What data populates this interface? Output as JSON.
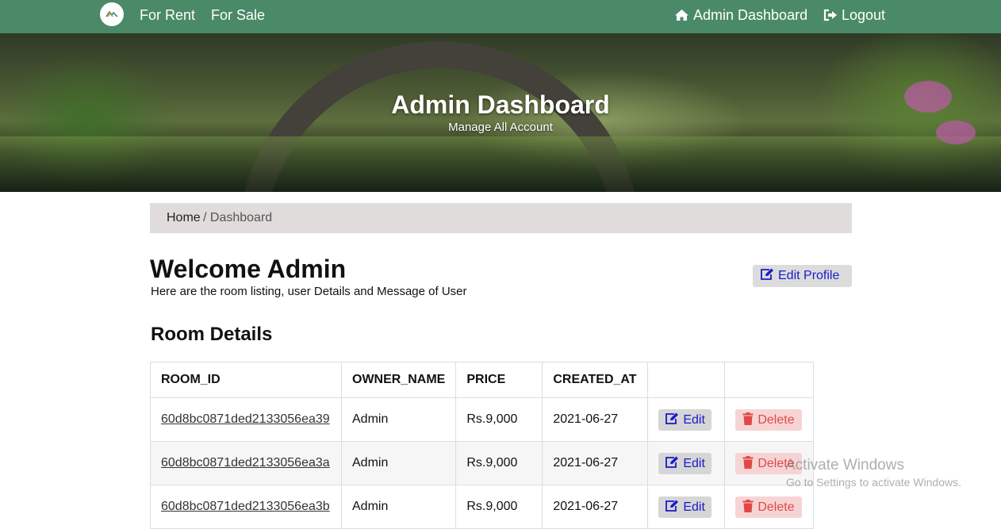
{
  "navbar": {
    "links": {
      "rent": "For Rent",
      "sale": "For Sale"
    },
    "admin_dashboard": "Admin Dashboard",
    "logout": "Logout"
  },
  "hero": {
    "title": "Admin Dashboard",
    "subtitle": "Manage All Account"
  },
  "breadcrumb": {
    "home": "Home",
    "rest": "/ Dashboard"
  },
  "welcome": {
    "title": "Welcome Admin",
    "subtitle": "Here are the room listing, user Details and Message of User",
    "edit_profile": "Edit Profile"
  },
  "room_section": {
    "title": "Room Details"
  },
  "table": {
    "headers": [
      "ROOM_ID",
      "OWNER_NAME",
      "PRICE",
      "CREATED_AT"
    ],
    "edit_label": "Edit",
    "delete_label": "Delete",
    "rows": [
      {
        "room_id": "60d8bc0871ded2133056ea39",
        "owner": "Admin",
        "price": "Rs.9,000",
        "created": "2021-06-27"
      },
      {
        "room_id": "60d8bc0871ded2133056ea3a",
        "owner": "Admin",
        "price": "Rs.9,000",
        "created": "2021-06-27"
      },
      {
        "room_id": "60d8bc0871ded2133056ea3b",
        "owner": "Admin",
        "price": "Rs.9,000",
        "created": "2021-06-27"
      }
    ]
  },
  "watermark": {
    "title": "Activate Windows",
    "subtitle": "Go to Settings to activate Windows."
  },
  "colors": {
    "navbar": "#4a8a68",
    "link_blue": "#1a1acc",
    "delete_red": "#e04848"
  },
  "icons": {
    "home": "home-icon",
    "logout": "sign-out-icon",
    "edit": "edit-icon",
    "delete": "trash-icon"
  }
}
